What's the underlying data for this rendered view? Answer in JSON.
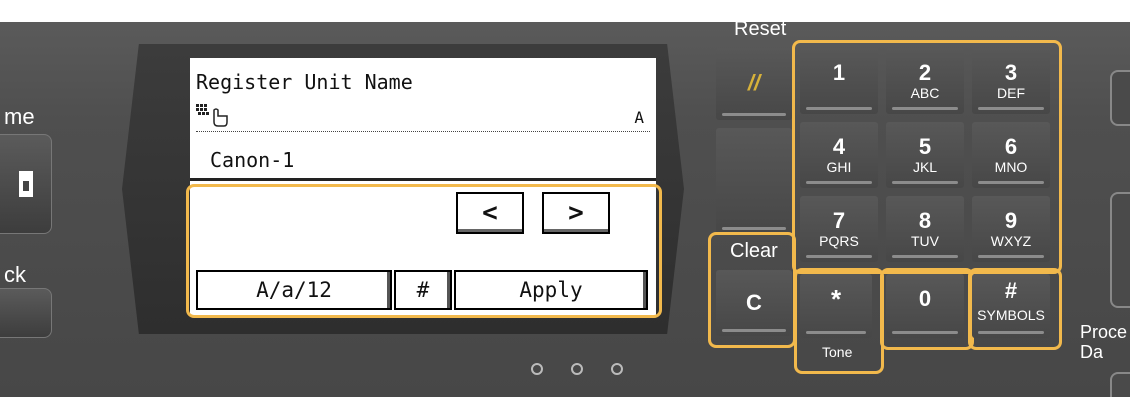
{
  "left_panel": {
    "label_top": "me",
    "label_bottom": "ck"
  },
  "lcd": {
    "title": "Register Unit Name",
    "cursor_icon": "hand-pointer-icon",
    "input_mode": "A",
    "value": "Canon-1",
    "arrows": {
      "left": "<",
      "right": ">"
    },
    "softkeys": {
      "mode": "A/a/12",
      "symbol": "#",
      "apply": "Apply"
    }
  },
  "keypad": {
    "reset_label": "Reset",
    "reset_icon": "//",
    "clear_label": "Clear",
    "clear_key": "C",
    "keys": [
      {
        "num": "1",
        "sub": ""
      },
      {
        "num": "2",
        "sub": "ABC"
      },
      {
        "num": "3",
        "sub": "DEF"
      },
      {
        "num": "4",
        "sub": "GHI"
      },
      {
        "num": "5",
        "sub": "JKL"
      },
      {
        "num": "6",
        "sub": "MNO"
      },
      {
        "num": "7",
        "sub": "PQRS"
      },
      {
        "num": "8",
        "sub": "TUV"
      },
      {
        "num": "9",
        "sub": "WXYZ"
      }
    ],
    "star": "*",
    "tone_label": "Tone",
    "zero": "0",
    "hash": "#",
    "symbols_label": "SYMBOLS"
  },
  "right_panel": {
    "label": "Proce\nDa"
  },
  "colors": {
    "highlight": "#f2b94c",
    "panel": "#4f4f4f",
    "reset_icon": "#d8b23a"
  }
}
